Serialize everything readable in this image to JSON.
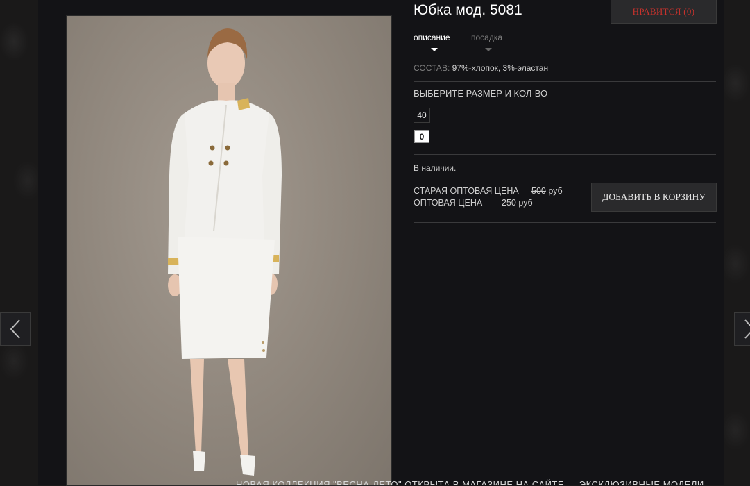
{
  "product": {
    "title": "Юбка мод. 5081",
    "like_label": "НРАВИТСЯ (0)",
    "tabs": [
      {
        "label": "описание",
        "active": true
      },
      {
        "label": "посадка",
        "active": false
      }
    ],
    "composition_label": "СОСТАВ:",
    "composition_value": "97%-хлопок, 3%-эластан",
    "size_heading": "ВЫБЕРИТЕ РАЗМЕР И КОЛ-ВО",
    "size": "40",
    "quantity": "0",
    "availability": "В наличии.",
    "old_price_label": "СТАРАЯ ОПТОВАЯ ЦЕНА",
    "old_price_value": "500",
    "old_price_currency": "руб",
    "price_label": "ОПТОВАЯ ЦЕНА",
    "price_value": "250 руб",
    "cart_label": "ДОБАВИТЬ В КОРЗИНУ"
  },
  "nav": {
    "prev_icon": "chevron-left-icon",
    "next_icon": "chevron-right-icon"
  },
  "ticker": {
    "text": "НОВАЯ КОЛЛЕКЦИЯ \"ВЕСНА-ЛЕТО\" ОТКРЫТА В МАГАЗИНЕ НА САЙТЕ — ЭКСКЛЮЗИВНЫЕ МОДЕЛИ"
  },
  "colors": {
    "background": "#131316",
    "like_text": "#c8322c",
    "button_bg": "#2a2a2c"
  }
}
